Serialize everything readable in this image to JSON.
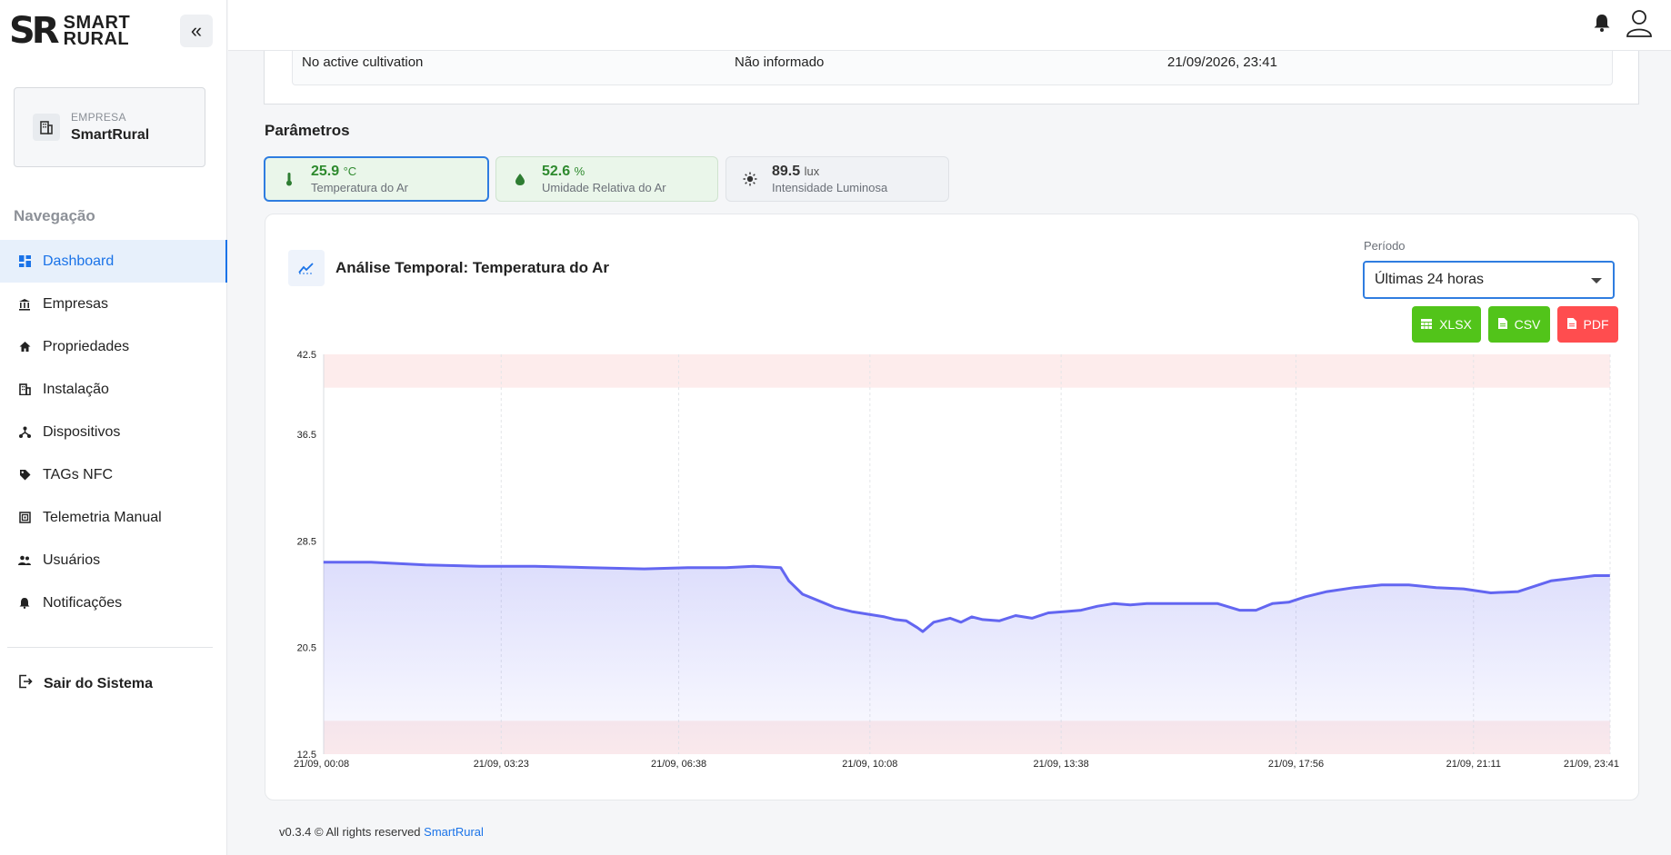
{
  "brand": {
    "mark": "SR",
    "line1": "SMART",
    "line2": "RURAL"
  },
  "company": {
    "label": "EMPRESA",
    "name": "SmartRural"
  },
  "nav": {
    "title": "Navegação",
    "items": [
      {
        "label": "Dashboard",
        "icon": "dashboard-icon",
        "active": true
      },
      {
        "label": "Empresas",
        "icon": "bank-icon"
      },
      {
        "label": "Propriedades",
        "icon": "home-icon"
      },
      {
        "label": "Instalação",
        "icon": "building-icon"
      },
      {
        "label": "Dispositivos",
        "icon": "network-icon"
      },
      {
        "label": "TAGs NFC",
        "icon": "tag-icon"
      },
      {
        "label": "Telemetria Manual",
        "icon": "telemetry-icon"
      },
      {
        "label": "Usuários",
        "icon": "users-icon"
      },
      {
        "label": "Notificações",
        "icon": "bell-icon"
      }
    ],
    "logout": "Sair do Sistema"
  },
  "cultivation": {
    "name": "No active cultivation",
    "info": "Não informado",
    "date": "21/09/2026, 23:41"
  },
  "params": {
    "title": "Parâmetros",
    "items": [
      {
        "value": "25.9",
        "unit": "°C",
        "label": "Temperatura do Ar",
        "icon": "thermometer-icon"
      },
      {
        "value": "52.6",
        "unit": "%",
        "label": "Umidade Relativa do Ar",
        "icon": "drop-icon"
      },
      {
        "value": "89.5",
        "unit": "lux",
        "label": "Intensidade Luminosa",
        "icon": "sun-icon"
      }
    ]
  },
  "chart_panel": {
    "title": "Análise Temporal: Temperatura do Ar",
    "period_label": "Período",
    "period_value": "Últimas 24 horas",
    "buttons": {
      "xlsx": "XLSX",
      "csv": "CSV",
      "pdf": "PDF"
    }
  },
  "chart_data": {
    "type": "area",
    "y_ticks": [
      "42.5",
      "36.5",
      "28.5",
      "20.5",
      "12.5"
    ],
    "ylim": [
      12.5,
      42.5
    ],
    "x_ticks": [
      "21/09, 00:08",
      "21/09, 03:23",
      "21/09, 06:38",
      "21/09, 10:08",
      "21/09, 13:38",
      "21/09, 17:56",
      "21/09, 21:11",
      "21/09, 23:41"
    ],
    "x_tick_hours": [
      0.133,
      3.383,
      6.633,
      10.133,
      13.633,
      17.933,
      21.183,
      23.683
    ],
    "alert_bands": [
      {
        "from": 40.0,
        "to": 42.5
      },
      {
        "from": 12.5,
        "to": 15.0
      }
    ],
    "series": [
      {
        "color": "#6366f1",
        "x": [
          0.13,
          1.0,
          2.0,
          3.0,
          4.0,
          5.0,
          6.0,
          6.8,
          7.5,
          8.0,
          8.5,
          8.65,
          8.9,
          9.2,
          9.5,
          9.8,
          10.1,
          10.4,
          10.6,
          10.8,
          11.0,
          11.1,
          11.3,
          11.6,
          11.8,
          12.0,
          12.2,
          12.5,
          12.8,
          13.1,
          13.4,
          13.7,
          14.0,
          14.3,
          14.6,
          14.9,
          15.2,
          15.5,
          16.0,
          16.5,
          16.9,
          17.2,
          17.5,
          17.8,
          18.1,
          18.5,
          19.0,
          19.5,
          20.0,
          20.5,
          21.0,
          21.5,
          22.0,
          22.3,
          22.6,
          23.0,
          23.4,
          23.68
        ],
        "y": [
          26.9,
          26.9,
          26.7,
          26.6,
          26.6,
          26.5,
          26.4,
          26.5,
          26.5,
          26.6,
          26.5,
          25.5,
          24.5,
          24.0,
          23.5,
          23.2,
          23.0,
          22.8,
          22.6,
          22.5,
          22.0,
          21.7,
          22.4,
          22.7,
          22.4,
          22.8,
          22.6,
          22.5,
          22.9,
          22.7,
          23.1,
          23.2,
          23.3,
          23.6,
          23.8,
          23.7,
          23.8,
          23.8,
          23.8,
          23.8,
          23.3,
          23.3,
          23.8,
          23.9,
          24.3,
          24.7,
          25.0,
          25.2,
          25.2,
          25.0,
          24.9,
          24.6,
          24.7,
          25.1,
          25.5,
          25.7,
          25.9,
          25.9
        ]
      }
    ]
  },
  "footer": {
    "text": "v0.3.4 © All rights reserved",
    "link": "SmartRural"
  }
}
